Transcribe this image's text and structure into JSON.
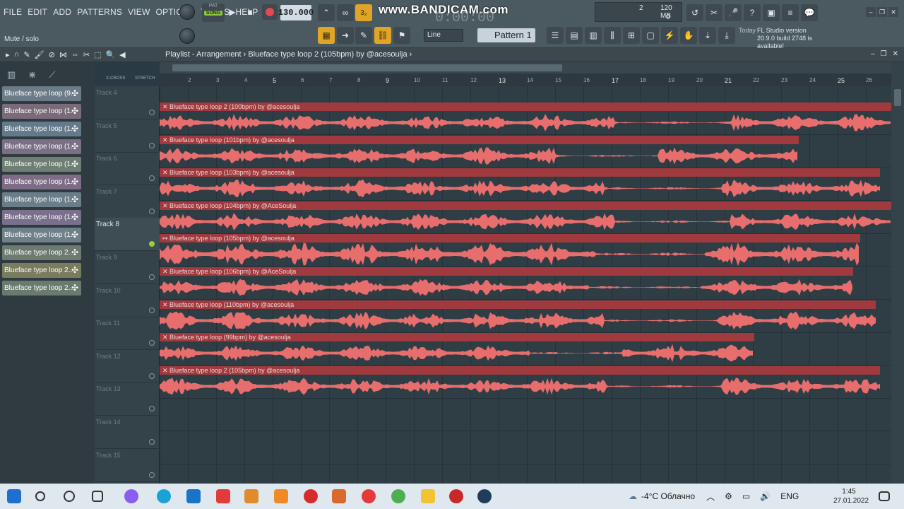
{
  "menu": [
    "FILE",
    "EDIT",
    "ADD",
    "PATTERNS",
    "VIEW",
    "OPTIONS",
    "TOOLS",
    "HELP"
  ],
  "hint_bar": "Mute / solo",
  "transport": {
    "pat_label": "PAT",
    "song_label": "SONG",
    "tempo": "130.000"
  },
  "watermark": "www.BANDICAM.com",
  "timer": "0:00:00",
  "cpu_panel": {
    "voices": "2",
    "memory": "120 MB",
    "cpu": "0"
  },
  "toolbar2": {
    "snap_value": "Line",
    "pattern_value": "Pattern 1"
  },
  "news": {
    "label": "Today",
    "line1": "FL Studio version",
    "line2": "20.9.0 build 2748 is available!"
  },
  "playlist": {
    "title": "Playlist - Arrangement",
    "breadcrumb": "Blueface type loop 2 (105bpm) by @acesoulja"
  },
  "left_tools": {
    "xcross": "X-CROSS",
    "stretch": "STRETCH"
  },
  "clip_list": [
    "Blueface type loop (9...",
    "Blueface type loop (1...",
    "Blueface type loop (1...",
    "Blueface type loop (1...",
    "Blueface type loop (1...",
    "Blueface type loop (1...",
    "Blueface type loop (1...",
    "Blueface type loop (1...",
    "Blueface type loop (1...",
    "Blueface type loop 2...",
    "Blueface type loop 2...",
    "Blueface type loop 2..."
  ],
  "ruler": [
    "2",
    "3",
    "4",
    "5",
    "6",
    "7",
    "8",
    "9",
    "10",
    "11",
    "12",
    "13",
    "14",
    "15",
    "16",
    "17",
    "18",
    "19",
    "20",
    "21",
    "22",
    "23",
    "24",
    "25",
    "26"
  ],
  "tracks": [
    {
      "name": "Track 4",
      "clip": "Blueface type loop 2 (100bpm) by @acesoulja"
    },
    {
      "name": "Track 5",
      "clip": "Blueface type loop (101bpm) by @acesoulja"
    },
    {
      "name": "Track 6",
      "clip": "Blueface type loop (103bpm) by @acesoulja"
    },
    {
      "name": "Track 7",
      "clip": "Blueface type loop (104bpm) by @AceSoulja"
    },
    {
      "name": "Track 8",
      "clip": "Blueface type loop (105bpm) by @acesoulja"
    },
    {
      "name": "Track 9",
      "clip": "Blueface type loop (106bpm) by @AceSoulja"
    },
    {
      "name": "Track 10",
      "clip": "Blueface type loop (110bpm) by @acesoulja"
    },
    {
      "name": "Track 11",
      "clip": "Blueface type loop (99bpm) by @acesoulja"
    },
    {
      "name": "Track 12",
      "clip": "Blueface type loop 2 (105bpm) by @acesoulja"
    },
    {
      "name": "Track 13",
      "clip": ""
    },
    {
      "name": "Track 14",
      "clip": ""
    },
    {
      "name": "Track 15",
      "clip": ""
    }
  ],
  "taskbar": {
    "weather": "-4°C Облачно",
    "lang": "ENG",
    "time": "1:45",
    "date": "27.01.2022"
  },
  "colors": {
    "clip_bar": "#a03a3e",
    "wave": "#e86e6e",
    "accent": "#9bd12f"
  }
}
